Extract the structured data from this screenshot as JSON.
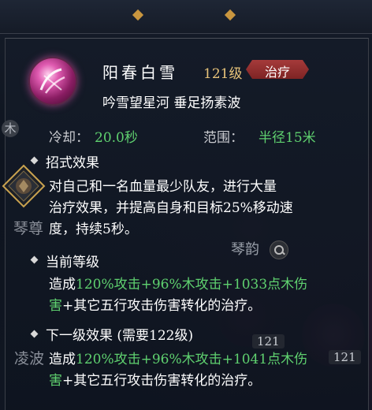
{
  "skill": {
    "name": "阳春白雪",
    "level": "121级",
    "tag": "治疗",
    "subtitle": "吟雪望星河 垂足扬素波"
  },
  "stats": {
    "cooldown_label": "冷却：",
    "cooldown_value": "20.0秒",
    "range_label": "范围：",
    "range_value": "半径15米"
  },
  "sections": {
    "effect_title": "招式效果",
    "effect_lines": [
      "对自己和一名血量最少队友，进行大量",
      "治疗效果，并提高自身和目标25%移动速",
      "度，持续5秒。"
    ],
    "current_title": "当前等级",
    "current_parts": [
      {
        "text": "造成",
        "color": "white"
      },
      {
        "text": "120%攻击+96%木攻击+1033点木伤",
        "color": "green"
      }
    ],
    "current_line2": [
      {
        "text": "害",
        "color": "green"
      },
      {
        "text": "+其它五行攻击伤害转化的治疗。",
        "color": "white"
      }
    ],
    "next_title": "下一级效果 (需要122级)",
    "next_parts": [
      {
        "text": "造成",
        "color": "white"
      },
      {
        "text": "120%攻击+96%木攻击+1041点木伤",
        "color": "green"
      }
    ],
    "next_line2": [
      {
        "text": "害",
        "color": "green"
      },
      {
        "text": "+其它五行攻击伤害转化的治疗。",
        "color": "white"
      }
    ]
  },
  "background": {
    "side_wood": "木",
    "side_qinzun": "琴尊",
    "side_lingbo": "凌波",
    "qinyun": "琴韵",
    "badge_121a": "121",
    "badge_121b": "121"
  },
  "colors": {
    "accent_green": "#5fd16f",
    "gold": "#e8c37a",
    "tag_red": "#a53a3a"
  }
}
